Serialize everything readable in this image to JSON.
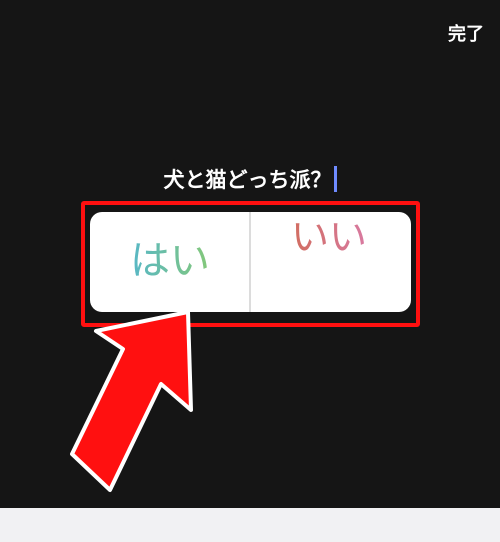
{
  "header": {
    "done_label": "完了"
  },
  "story": {
    "question": "犬と猫どっち派？"
  },
  "poll": {
    "option_left": "はい",
    "option_right": "いい",
    "colors": {
      "left_gradient": [
        "#57b7c7",
        "#84c879"
      ],
      "right_gradient": [
        "#d16d5f",
        "#d87aa1"
      ]
    }
  },
  "overlay": {
    "highlight_color": "#ff1010",
    "arrow_color": "#ff1010"
  },
  "icons": {
    "arrow": "arrow-up-right-icon"
  }
}
